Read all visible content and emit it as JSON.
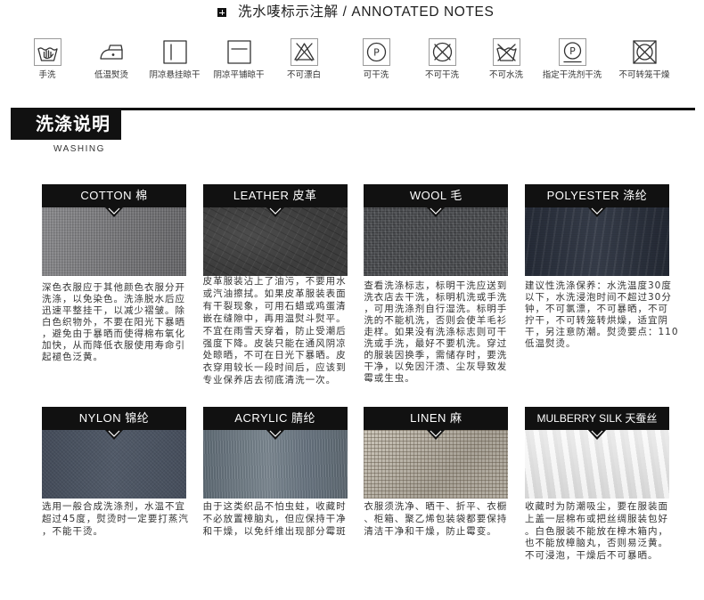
{
  "theme": {
    "bar_color": "#111111",
    "text_color": "#333333"
  },
  "header": {
    "icon": "square-plus-icon",
    "title": "洗水唛标示注解 / ANNOTATED NOTES"
  },
  "care_symbols": [
    {
      "icon": "hand-wash-icon",
      "label": "手洗"
    },
    {
      "icon": "iron-low-temperature-icon",
      "label": "低温熨烫"
    },
    {
      "icon": "drip-dry-shade-icon",
      "label": "阴凉悬挂晾干"
    },
    {
      "icon": "dry-flat-shade-icon",
      "label": "阴凉平铺晾干"
    },
    {
      "icon": "no-bleach-icon",
      "label": "不可漂白"
    },
    {
      "icon": "dry-clean-icon",
      "letter": "P",
      "label": "可干洗"
    },
    {
      "icon": "no-dry-clean-icon",
      "label": "不可干洗"
    },
    {
      "icon": "no-wash-icon",
      "label": "不可水洗"
    },
    {
      "icon": "dry-clean-specified-solvent-icon",
      "letter": "P",
      "label": "指定干洗剂干洗"
    },
    {
      "icon": "no-tumble-dry-icon",
      "label": "不可转笼干燥"
    }
  ],
  "section": {
    "title": "洗涤说明",
    "subtitle": "WASHING"
  },
  "fabrics": [
    {
      "name": "COTTON 棉",
      "text": "深色衣服应于其他颜色衣服分开\n洗涤，以免染色。洗涤脱水后应\n迅速平整挂干，以减少褶皱。除\n白色织物外，不要在阳光下暴晒\n，避免由于暴晒而使得棉布氧化\n加快，从而降低衣服使用寿命引\n起褪色泛黄。"
    },
    {
      "name": "LEATHER 皮革",
      "text": "皮革服装沾上了油污，不要用水\n或汽油擦拭。如果皮革服装表面\n有干裂现象，可用石蜡或鸡蛋清\n嵌在缝隙中，再用温熨斗熨平。\n不宜在雨雪天穿着，防止受潮后\n强度下降。皮装只能在通风阴凉\n处晾晒，不可在日光下暴晒。皮\n衣穿用较长一段时间后，应该到\n专业保养店去彻底清洗一次。"
    },
    {
      "name": "WOOL 毛",
      "text": "查看洗涤标志，标明干洗应送到\n洗衣店去干洗，标明机洗或手洗\n，可用洗涤剂自行湿洗。标明手\n洗的不能机洗，否则会使羊毛衫\n走样。如果没有洗涤标志则可干\n洗或手洗，最好不要机洗。穿过\n的服装因换季，需储存时，要洗\n干净，以免因汗渍、尘灰导致发\n霉或生虫。"
    },
    {
      "name": "POLYESTER 涤纶",
      "text": "建议性洗涤保养：水洗温度30度\n以下，水洗浸泡时间不超过30分\n钟，不可氯漂，不可暴晒，不可\n拧干，不可转笼转烘燥，适宜阴\n干，另注意防潮。熨烫要点：110\n低温熨烫。"
    },
    {
      "name": "NYLON 锦纶",
      "text": "选用一般合成洗涤剂，水温不宜\n超过45度，熨烫时一定要打蒸汽\n，不能干烫。"
    },
    {
      "name": "ACRYLIC 腈纶",
      "text": "由于这类织品不怕虫蛀，收藏时\n不必放置樟脑丸，但应保持干净\n和干燥，以免纤维出现部分霉斑"
    },
    {
      "name": "LINEN 麻",
      "text": "衣服须洗净、晒干、折平、衣橱\n、柜箱、聚乙烯包装袋都要保持\n清洁干净和干燥，防止霉变。"
    },
    {
      "name": "MULBERRY SILK 天蚕丝",
      "text": "收藏时为防潮吸尘，要在服装面\n上盖一层棉布或把丝绸服装包好\n。白色服装不能放在樟木箱内，\n也不能放樟脑丸，否则易泛黄。\n不可浸泡，干燥后不可暴晒。"
    }
  ]
}
